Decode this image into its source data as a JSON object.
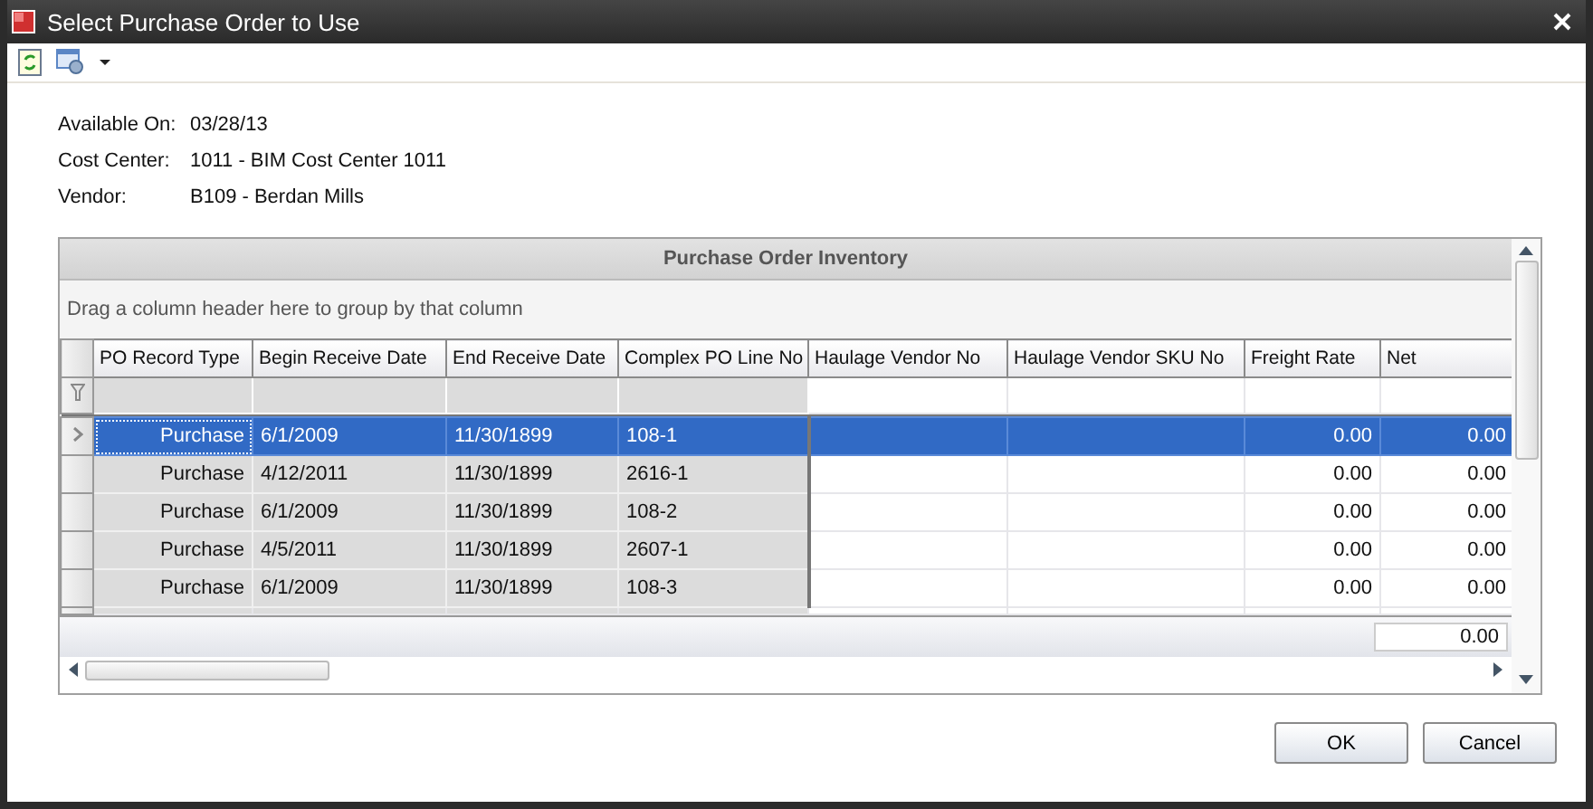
{
  "window": {
    "title": "Select Purchase Order to Use"
  },
  "fields": [
    {
      "label": "Available On:",
      "value": "03/28/13"
    },
    {
      "label": "Cost Center:",
      "value": "1011 - BIM Cost Center 1011"
    },
    {
      "label": "Vendor:",
      "value": "B109 - Berdan Mills"
    }
  ],
  "grid": {
    "title": "Purchase Order Inventory",
    "group_hint": "Drag a column header here to group by that column",
    "columns": [
      "PO Record Type",
      "Begin Receive Date",
      "End Receive Date",
      "Complex PO Line No",
      "Haulage Vendor No",
      "Haulage Vendor SKU No",
      "Freight Rate",
      "Net"
    ],
    "rows": [
      {
        "selected": true,
        "cells": [
          "Purchase",
          "6/1/2009",
          "11/30/1899",
          "108-1",
          "",
          "",
          "0.00",
          "0.00"
        ]
      },
      {
        "selected": false,
        "cells": [
          "Purchase",
          "4/12/2011",
          "11/30/1899",
          "2616-1",
          "",
          "",
          "0.00",
          "0.00"
        ]
      },
      {
        "selected": false,
        "cells": [
          "Purchase",
          "6/1/2009",
          "11/30/1899",
          "108-2",
          "",
          "",
          "0.00",
          "0.00"
        ]
      },
      {
        "selected": false,
        "cells": [
          "Purchase",
          "4/5/2011",
          "11/30/1899",
          "2607-1",
          "",
          "",
          "0.00",
          "0.00"
        ]
      },
      {
        "selected": false,
        "cells": [
          "Purchase",
          "6/1/2009",
          "11/30/1899",
          "108-3",
          "",
          "",
          "0.00",
          "0.00"
        ]
      }
    ],
    "net_total": "0.00"
  },
  "buttons": [
    "OK",
    "Cancel"
  ]
}
